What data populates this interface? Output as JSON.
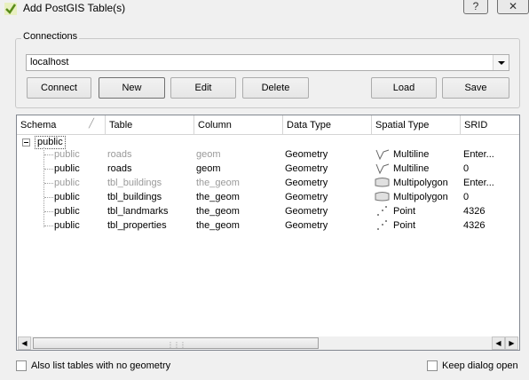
{
  "window": {
    "title": "Add PostGIS Table(s)",
    "help_label": "?",
    "close_label": "✕"
  },
  "connections": {
    "group_label": "Connections",
    "selected": "localhost",
    "buttons": {
      "connect": "Connect",
      "new": "New",
      "edit": "Edit",
      "delete": "Delete",
      "load": "Load",
      "save": "Save"
    }
  },
  "table": {
    "columns": [
      "Schema",
      "Table",
      "Column",
      "Data Type",
      "Spatial Type",
      "SRID"
    ],
    "schema_node": "public",
    "rows": [
      {
        "schema": "public",
        "table": "roads",
        "column": "geom",
        "data_type": "Geometry",
        "spatial_type": "Multiline",
        "srid": "Enter...",
        "greyed": true,
        "icon": "multiline-icon"
      },
      {
        "schema": "public",
        "table": "roads",
        "column": "geom",
        "data_type": "Geometry",
        "spatial_type": "Multiline",
        "srid": "0",
        "greyed": false,
        "icon": "multiline-icon"
      },
      {
        "schema": "public",
        "table": "tbl_buildings",
        "column": "the_geom",
        "data_type": "Geometry",
        "spatial_type": "Multipolygon",
        "srid": "Enter...",
        "greyed": true,
        "icon": "multipolygon-icon"
      },
      {
        "schema": "public",
        "table": "tbl_buildings",
        "column": "the_geom",
        "data_type": "Geometry",
        "spatial_type": "Multipolygon",
        "srid": "0",
        "greyed": false,
        "icon": "multipolygon-icon"
      },
      {
        "schema": "public",
        "table": "tbl_landmarks",
        "column": "the_geom",
        "data_type": "Geometry",
        "spatial_type": "Point",
        "srid": "4326",
        "greyed": false,
        "icon": "point-icon"
      },
      {
        "schema": "public",
        "table": "tbl_properties",
        "column": "the_geom",
        "data_type": "Geometry",
        "spatial_type": "Point",
        "srid": "4326",
        "greyed": false,
        "icon": "point-icon"
      }
    ]
  },
  "options": {
    "list_no_geometry": "Also list tables with no geometry",
    "keep_dialog_open": "Keep dialog open"
  }
}
